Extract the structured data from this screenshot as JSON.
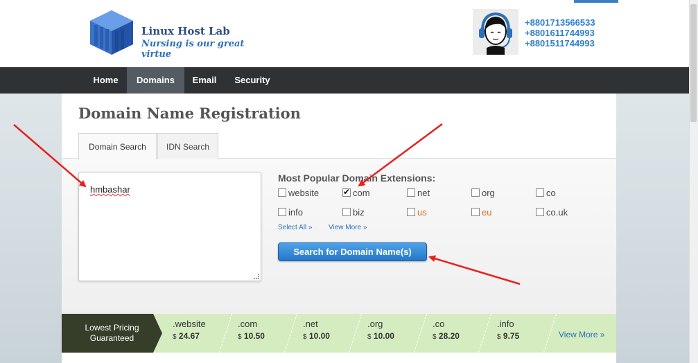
{
  "header": {
    "logo_name": "Linux Host Lab",
    "logo_tagline": "Nursing is our great virtue",
    "phones": [
      "+8801713566533",
      "+8801611744993",
      "+8801511744993"
    ]
  },
  "nav": {
    "items": [
      {
        "label": "Home",
        "active": false
      },
      {
        "label": "Domains",
        "active": true
      },
      {
        "label": "Email",
        "active": false
      },
      {
        "label": "Security",
        "active": false
      }
    ]
  },
  "page": {
    "title": "Domain Name Registration",
    "tabs": [
      {
        "label": "Domain Search",
        "active": true
      },
      {
        "label": "IDN Search",
        "active": false
      }
    ]
  },
  "search": {
    "textarea_value": "hmbashar",
    "extensions_heading": "Most Popular Domain Extensions:",
    "extensions": [
      {
        "label": "website",
        "checked": false
      },
      {
        "label": "com",
        "checked": true
      },
      {
        "label": "net",
        "checked": false
      },
      {
        "label": "org",
        "checked": false
      },
      {
        "label": "co",
        "checked": false
      },
      {
        "label": "info",
        "checked": false
      },
      {
        "label": "biz",
        "checked": false
      },
      {
        "label": "us",
        "checked": false
      },
      {
        "label": "eu",
        "checked": false
      },
      {
        "label": "co.uk",
        "checked": false
      }
    ],
    "select_all": "Select All »",
    "view_more": "View More »",
    "button_label": "Search for Domain Name(s)"
  },
  "pricing": {
    "label_line1": "Lowest Pricing",
    "label_line2": "Guaranteed",
    "currency": "$",
    "items": [
      {
        "tld": ".website",
        "price": "24.67"
      },
      {
        "tld": ".com",
        "price": "10.50"
      },
      {
        "tld": ".net",
        "price": "10.00"
      },
      {
        "tld": ".org",
        "price": "10.00"
      },
      {
        "tld": ".co",
        "price": "28.20"
      },
      {
        "tld": ".info",
        "price": "9.75"
      }
    ],
    "view_more": "View More »"
  },
  "colors": {
    "nav_bg": "#2f3234",
    "nav_active": "#555b62",
    "accent_blue": "#2d6fb8",
    "pricing_green": "#d5ecc0",
    "annotation_red": "#e8201c"
  }
}
